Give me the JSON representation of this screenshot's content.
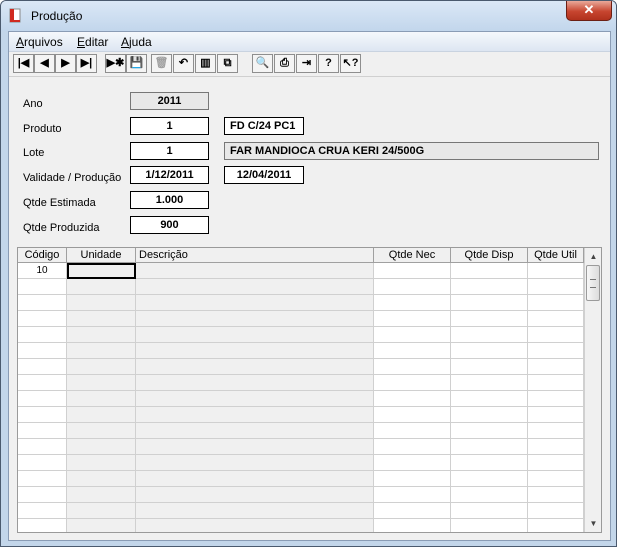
{
  "window": {
    "title": "Produção",
    "close_label": "✕"
  },
  "menu": [
    {
      "key": "A",
      "rest": "rquivos"
    },
    {
      "key": "E",
      "rest": "ditar"
    },
    {
      "key": "A",
      "rest": "juda"
    }
  ],
  "toolbar": [
    {
      "name": "first-record-button",
      "label": "|◀",
      "enabled": true
    },
    {
      "name": "previous-record-button",
      "label": "◀",
      "enabled": true
    },
    {
      "name": "next-record-button",
      "label": "▶",
      "enabled": true
    },
    {
      "name": "last-record-button",
      "label": "▶|",
      "enabled": true
    },
    {
      "name": "new-record-button",
      "label": "▶✱",
      "enabled": true
    },
    {
      "name": "save-button",
      "label": "💾",
      "enabled": true
    },
    {
      "name": "delete-button",
      "label": "🗑",
      "enabled": false
    },
    {
      "name": "undo-button",
      "label": "↶",
      "enabled": true
    },
    {
      "name": "books-button",
      "label": "▥",
      "enabled": true
    },
    {
      "name": "copy-button",
      "label": "⧉",
      "enabled": true
    },
    {
      "name": "find-button",
      "label": "🔍",
      "enabled": true
    },
    {
      "name": "print-button",
      "label": "⎙",
      "enabled": true
    },
    {
      "name": "exit-button",
      "label": "⇥",
      "enabled": true
    },
    {
      "name": "help-button",
      "label": "?",
      "enabled": true
    },
    {
      "name": "context-help-button",
      "label": "↖?",
      "enabled": true
    }
  ],
  "form": {
    "ano_label": "Ano",
    "ano_value": "2011",
    "produto_label": "Produto",
    "produto_value": "1",
    "produto_desc": "FD  C/24 PC1",
    "lote_label": "Lote",
    "lote_value": "1",
    "lote_desc": "FAR MANDIOCA CRUA KERI 24/500G",
    "validade_label": "Validade / Produção",
    "validade_value": "1/12/2011",
    "producao_value": "12/04/2011",
    "qtde_estimada_label": "Qtde Estimada",
    "qtde_estimada_value": "1.000",
    "qtde_produzida_label": "Qtde Produzida",
    "qtde_produzida_value": "900"
  },
  "grid": {
    "columns": [
      "Código",
      "Unidade",
      "Descrição",
      "Qtde Nec",
      "Qtde Disp",
      "Qtde Util"
    ],
    "rows": [
      [
        "10",
        "",
        "",
        "",
        "",
        ""
      ]
    ],
    "empty_row_count": 16
  },
  "colors": {
    "close": "#c7452f",
    "titlebar": "#c2d6ec",
    "client": "#f0f0f0"
  },
  "icons": {
    "app": "document-red-icon"
  }
}
